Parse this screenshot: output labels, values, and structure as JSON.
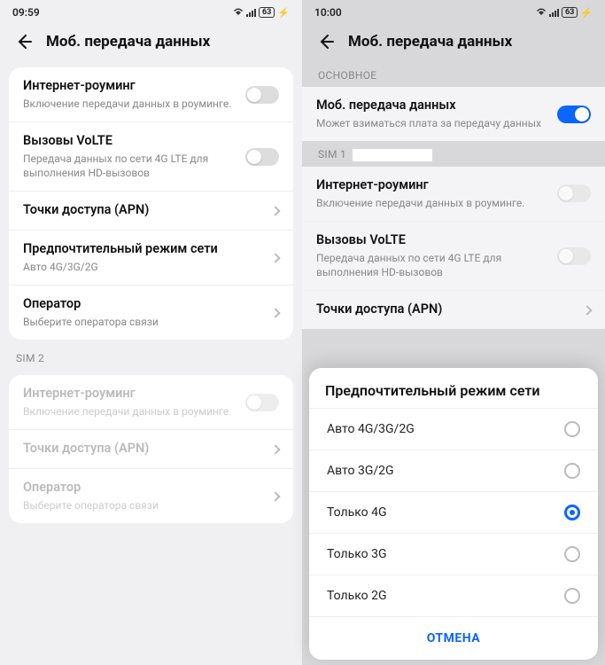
{
  "left": {
    "status": {
      "time": "09:59",
      "battery": "63"
    },
    "header": {
      "title": "Моб. передача данных"
    },
    "group1": {
      "roaming": {
        "title": "Интернет-роуминг",
        "sub": "Включение передачи данных в роуминге."
      },
      "volte": {
        "title": "Вызовы VoLTE",
        "sub": "Передача данных по сети 4G LTE для выполнения HD-вызовов"
      },
      "apn": {
        "title": "Точки доступа (APN)"
      },
      "mode": {
        "title": "Предпочтительный режим сети",
        "sub": "Авто 4G/3G/2G"
      },
      "operator": {
        "title": "Оператор",
        "sub": "Выберите оператора связи"
      }
    },
    "sim2_label": "SIM 2",
    "group2": {
      "roaming": {
        "title": "Интернет-роуминг",
        "sub": "Включение передачи данных в роуминге."
      },
      "apn": {
        "title": "Точки доступа (APN)"
      },
      "operator": {
        "title": "Оператор",
        "sub": "Выберите оператора связи"
      }
    }
  },
  "right": {
    "status": {
      "time": "10:00",
      "battery": "63"
    },
    "header": {
      "title": "Моб. передача данных"
    },
    "section_main": "ОСНОВНОЕ",
    "mobile_data": {
      "title": "Моб. передача данных",
      "sub": "Может взиматься плата за передачу данных"
    },
    "sim1_label": "SIM 1",
    "group1": {
      "roaming": {
        "title": "Интернет-роуминг",
        "sub": "Включение передачи данных в роуминге."
      },
      "volte": {
        "title": "Вызовы VoLTE",
        "sub": "Передача данных по сети 4G LTE для выполнения HD-вызовов"
      },
      "apn": {
        "title": "Точки доступа (APN)"
      }
    },
    "sheet": {
      "title": "Предпочтительный режим сети",
      "options": [
        {
          "label": "Авто 4G/3G/2G",
          "selected": false
        },
        {
          "label": "Авто 3G/2G",
          "selected": false
        },
        {
          "label": "Только 4G",
          "selected": true
        },
        {
          "label": "Только 3G",
          "selected": false
        },
        {
          "label": "Только 2G",
          "selected": false
        }
      ],
      "cancel": "ОТМЕНА"
    }
  }
}
